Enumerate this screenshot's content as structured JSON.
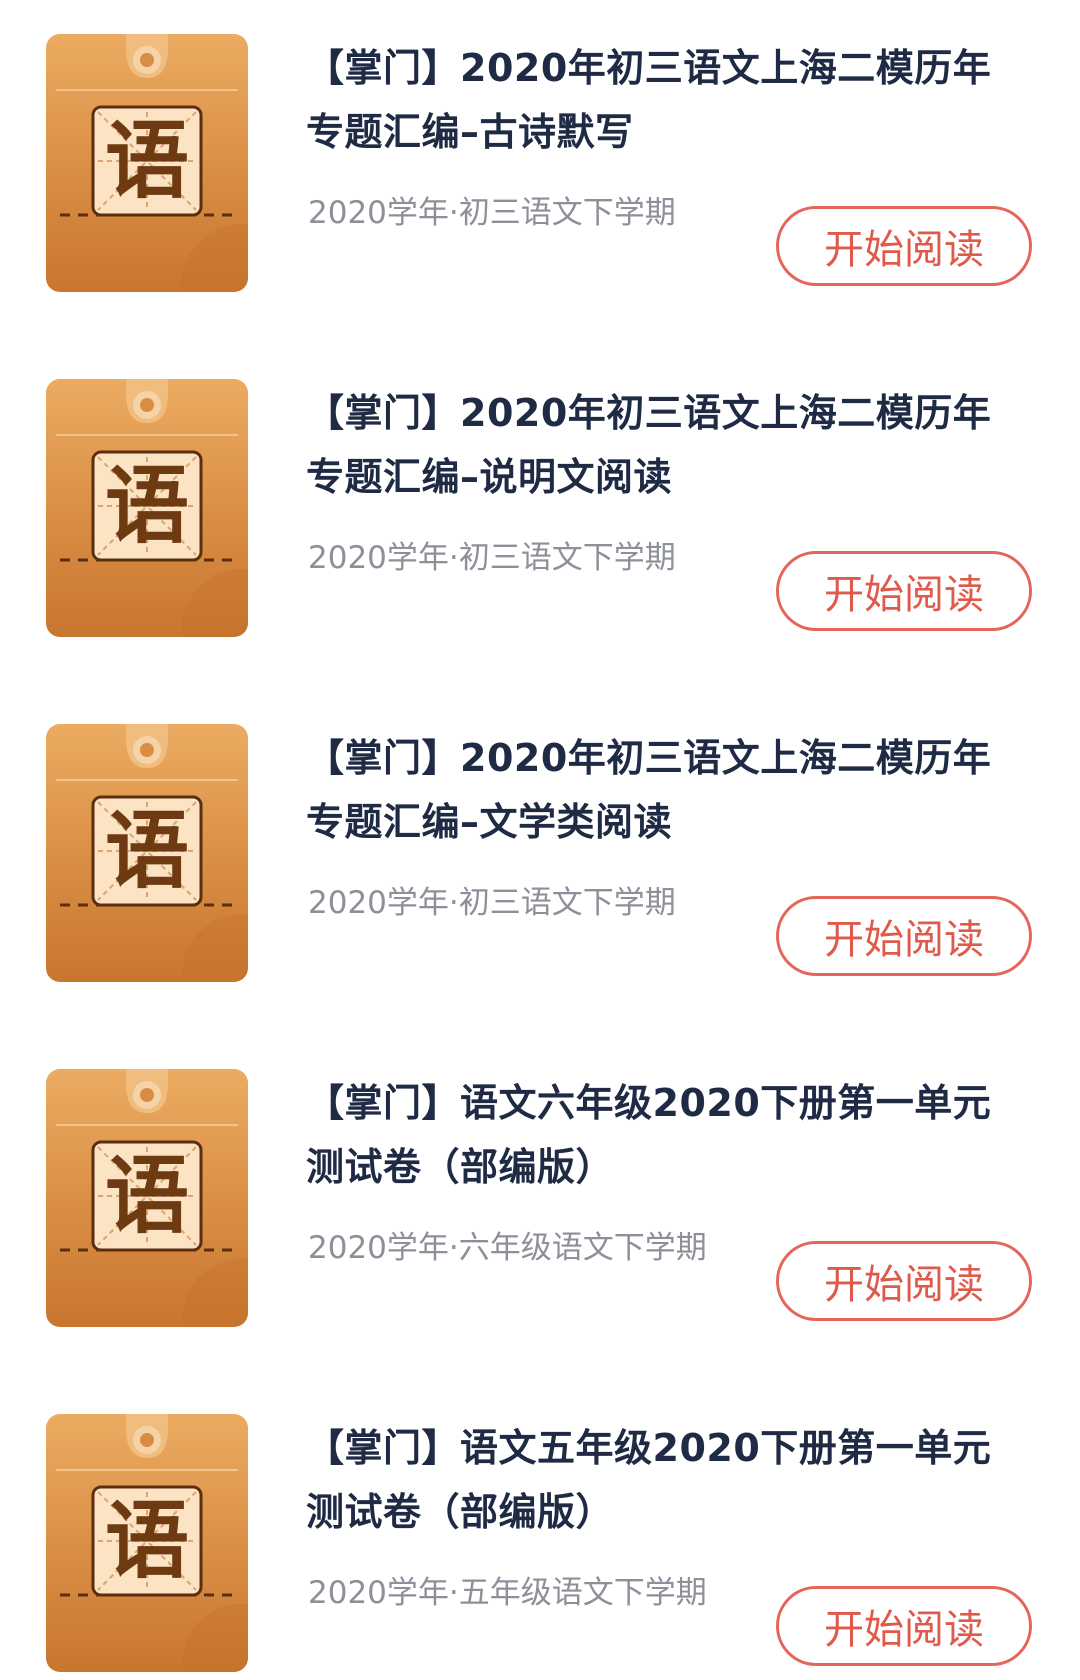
{
  "cover": {
    "char": "语",
    "icon": "chinese-subject-book-icon",
    "colors": {
      "top": "#ecab62",
      "bottom": "#c8762f",
      "tile": "#fbe3c4",
      "char": "#6e3a12"
    }
  },
  "button_color": "#e4665a",
  "items": [
    {
      "title": "【掌门】2020年初三语文上海二模历年专题汇编–古诗默写",
      "meta": "2020学年·初三语文下学期",
      "button": "开始阅读"
    },
    {
      "title": "【掌门】2020年初三语文上海二模历年专题汇编–说明文阅读",
      "meta": "2020学年·初三语文下学期",
      "button": "开始阅读"
    },
    {
      "title": "【掌门】2020年初三语文上海二模历年专题汇编–文学类阅读",
      "meta": "2020学年·初三语文下学期",
      "button": "开始阅读"
    },
    {
      "title": "【掌门】语文六年级2020下册第一单元测试卷（部编版）",
      "meta": "2020学年·六年级语文下学期",
      "button": "开始阅读"
    },
    {
      "title": "【掌门】语文五年级2020下册第一单元测试卷（部编版）",
      "meta": "2020学年·五年级语文下学期",
      "button": "开始阅读"
    }
  ]
}
